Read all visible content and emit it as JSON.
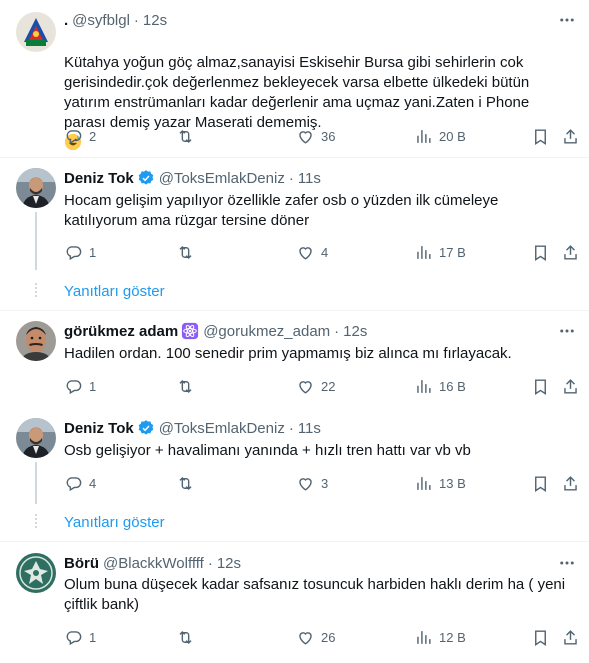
{
  "tweets": [
    {
      "name": ".",
      "handle": "@syfblgl",
      "sep": "·",
      "time": "12s",
      "text": "Kütahya yoğun göç almaz,sanayisi Eskisehir Bursa gibi sehirlerin cok gerisindedir.çok değerlenmez bekleyecek varsa elbette ülkedeki bütün yatırım enstrümanları kadar değerlenir ama uçmaz yani.Zaten i Phone parası demiş yazar Maserati dememiş.",
      "emoji": "sweat-smile",
      "replies": "2",
      "retweets": "",
      "likes": "36",
      "views": "20 B"
    },
    {
      "name": "Deniz Tok",
      "handle": "@ToksEmlakDeniz",
      "sep": "·",
      "time": "11s",
      "verified": true,
      "text": "Hocam gelişim yapılıyor özellikle zafer osb o yüzden ilk cümeleye katılıyorum ama rüzgar tersine döner",
      "replies": "1",
      "retweets": "",
      "likes": "4",
      "views": "17 B"
    },
    {
      "name": "görükmez adam",
      "handle": "@gorukmez_adam",
      "sep": "·",
      "time": "12s",
      "badge_icon": "atom-icon",
      "text": "Hadilen ordan. 100 senedir prim yapmamış biz alınca mı fırlayacak.",
      "replies": "1",
      "retweets": "",
      "likes": "22",
      "views": "16 B"
    },
    {
      "name": "Deniz Tok",
      "handle": "@ToksEmlakDeniz",
      "sep": "·",
      "time": "11s",
      "verified": true,
      "text": "Osb gelişiyor + havalimanı yanında + hızlı tren hattı var vb vb",
      "replies": "4",
      "retweets": "",
      "likes": "3",
      "views": "13 B"
    },
    {
      "name": "Börü",
      "handle": "@BlackkWolffff",
      "sep": "·",
      "time": "12s",
      "text": "Olum buna  düşecek kadar safsanız tosuncuk harbiden haklı derim ha ( yeni çiftlik bank)",
      "replies": "1",
      "retweets": "",
      "likes": "26",
      "views": "12 B"
    }
  ],
  "show_replies_label": "Yanıtları göster",
  "colors": {
    "link": "#1d9bf0",
    "secondary": "#536471",
    "divider": "#eff3f4",
    "verified": "#1d9bf0",
    "atom_badge": "#8b5cf6"
  }
}
